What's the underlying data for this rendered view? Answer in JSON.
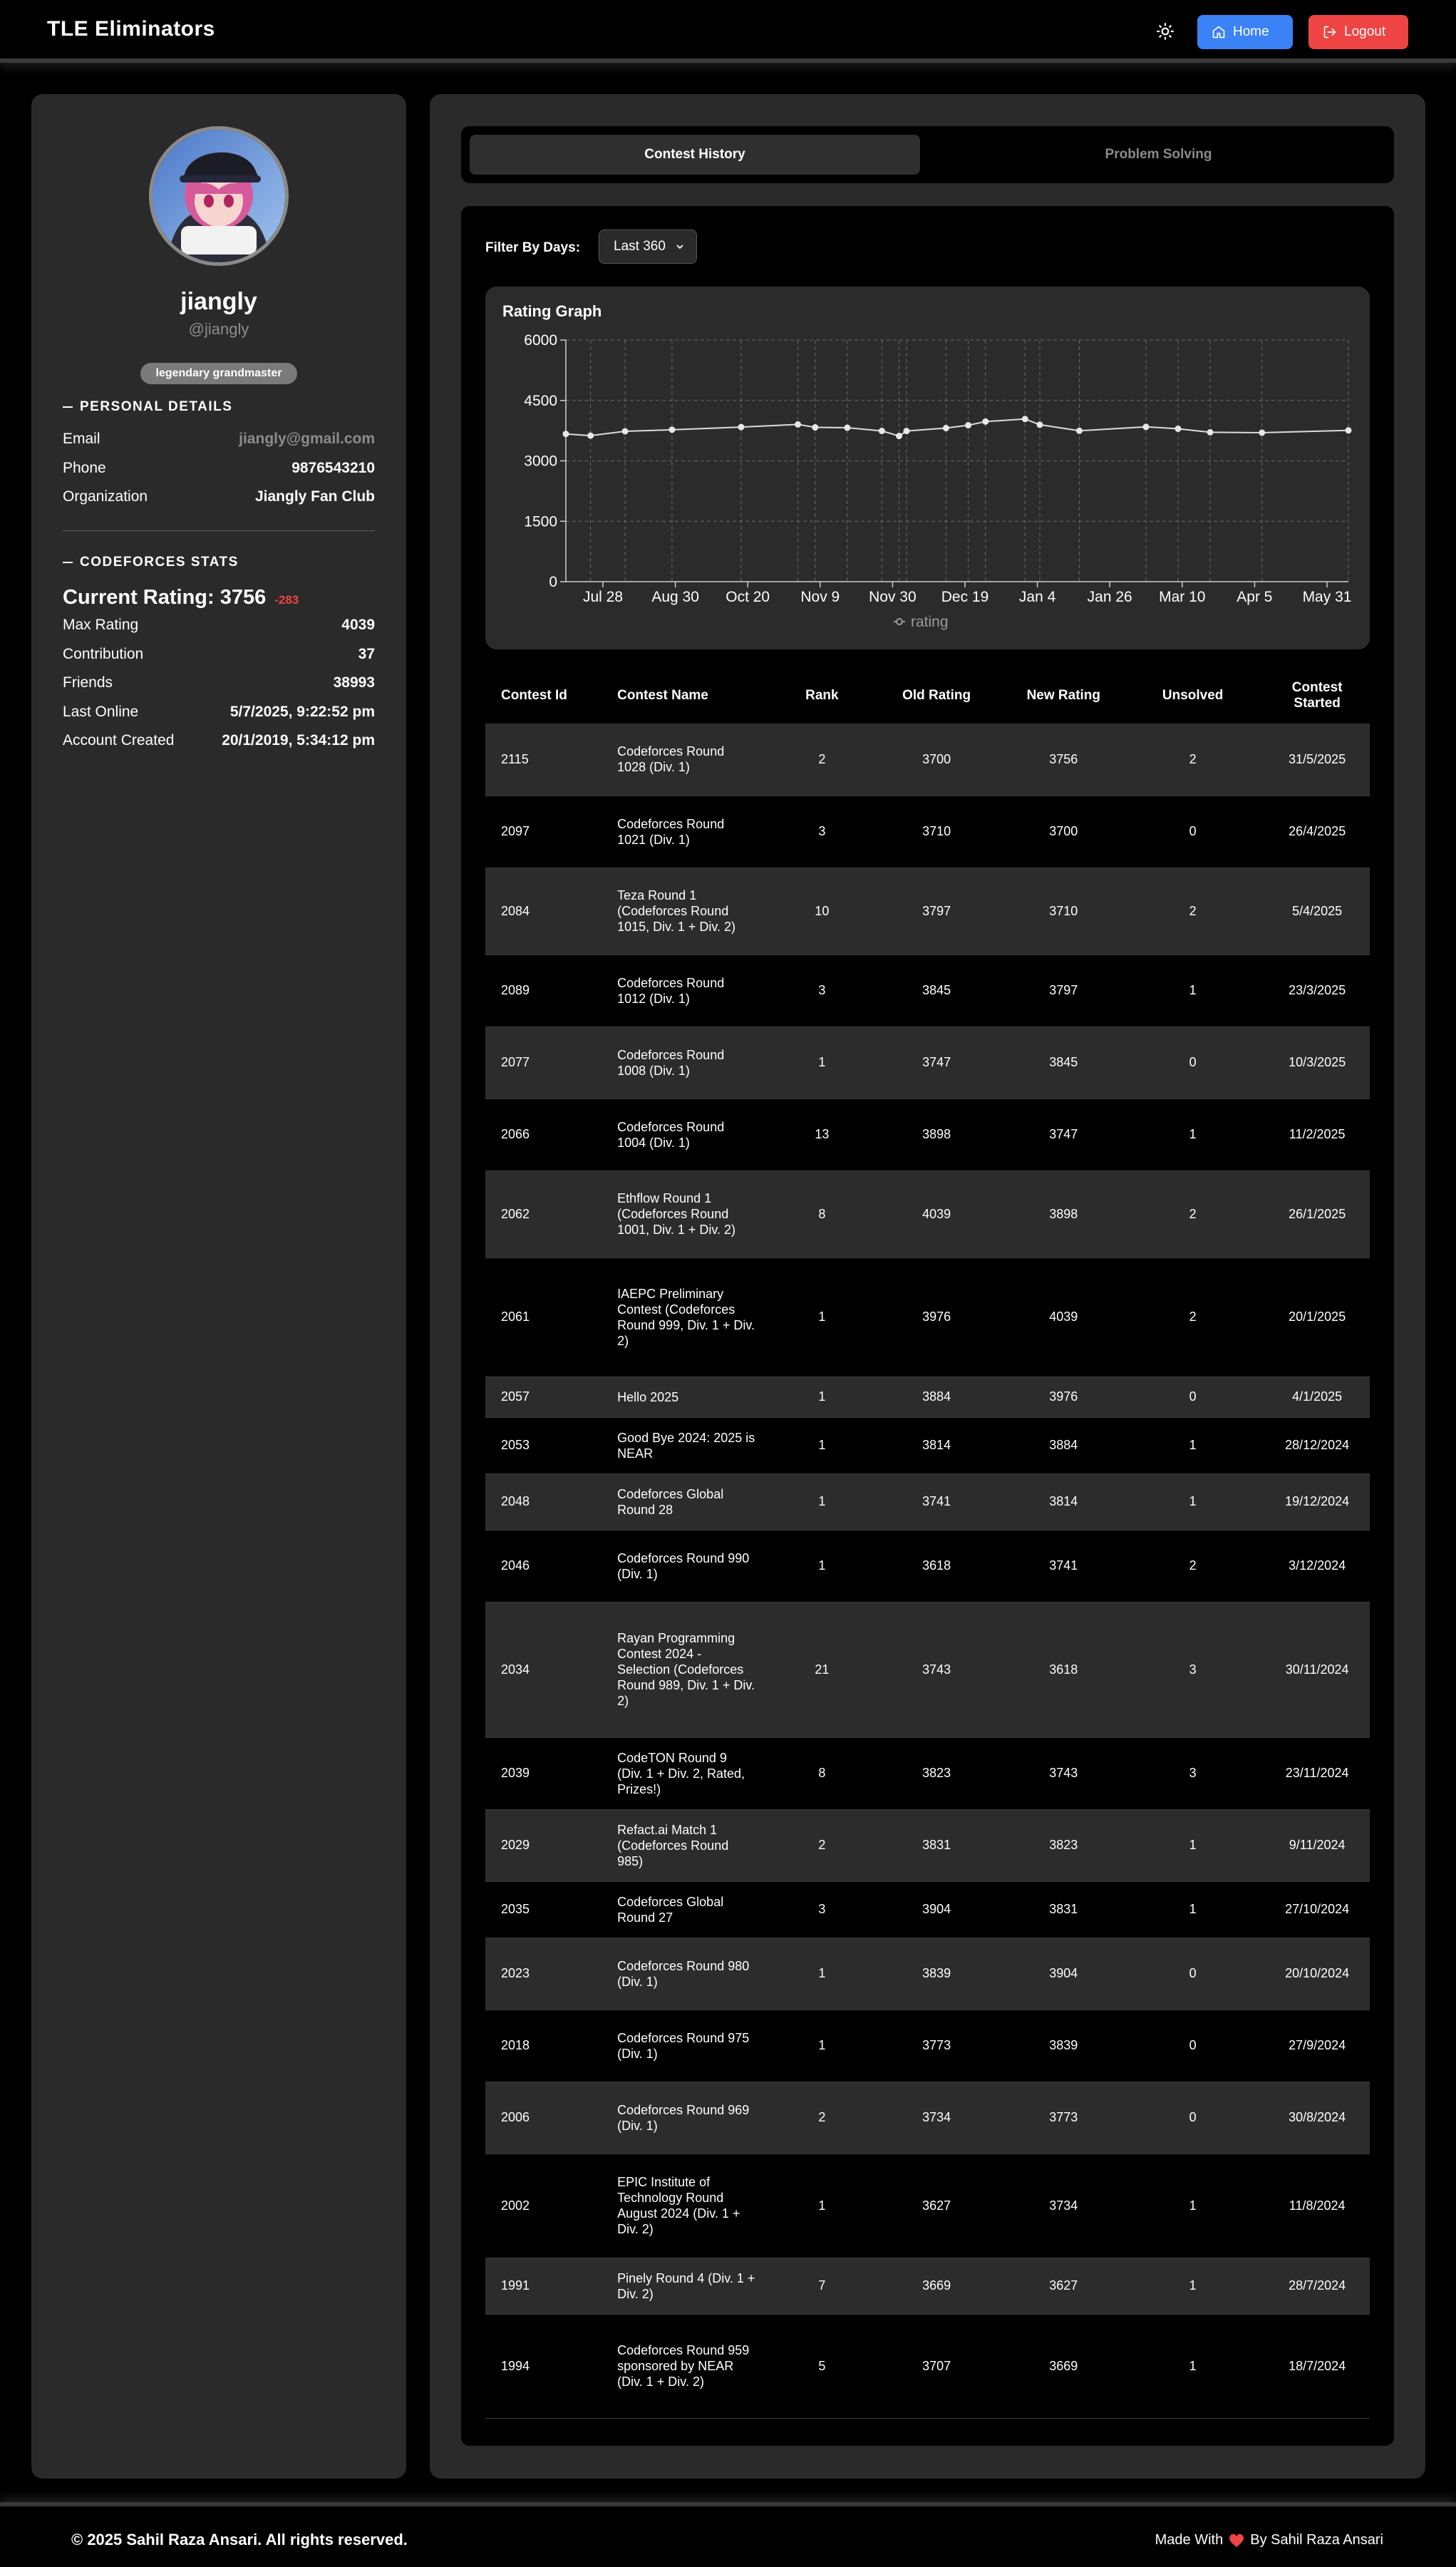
{
  "app": {
    "brand": "TLE Eliminators",
    "home_label": "Home",
    "logout_label": "Logout"
  },
  "profile": {
    "username": "jiangly",
    "handle": "@jiangly",
    "rank": "legendary grandmaster",
    "personal_title": "PERSONAL DETAILS",
    "personal": [
      {
        "label": "Email",
        "value": "jiangly@gmail.com"
      },
      {
        "label": "Phone",
        "value": "9876543210"
      },
      {
        "label": "Organization",
        "value": "Jiangly Fan Club"
      }
    ],
    "stats_title": "CODEFORCES STATS",
    "current_rating_label": "Current Rating: 3756",
    "current_rating_delta": "-283",
    "stats": [
      {
        "label": "Max Rating",
        "value": "4039"
      },
      {
        "label": "Contribution",
        "value": "37"
      },
      {
        "label": "Friends",
        "value": "38993"
      },
      {
        "label": "Last Online",
        "value": "5/7/2025, 9:22:52 pm"
      },
      {
        "label": "Account Created",
        "value": "20/1/2019, 5:34:12 pm"
      }
    ]
  },
  "tabs": {
    "contest_history": "Contest History",
    "problem_solving": "Problem Solving"
  },
  "filter": {
    "label": "Filter By Days:",
    "selected": "Last 360"
  },
  "chart_data": {
    "type": "line",
    "title": "Rating Graph",
    "legend": "rating",
    "legend_position": "bottom",
    "grid": true,
    "ylim": [
      0,
      6000
    ],
    "yticks": [
      "0",
      "1500",
      "3000",
      "4500",
      "6000"
    ],
    "xticks": [
      "Jul 28",
      "Aug 30",
      "Oct 20",
      "Nov 9",
      "Nov 30",
      "Dec 19",
      "Jan 4",
      "Jan 26",
      "Mar 10",
      "Apr 5",
      "May 31"
    ],
    "series": [
      {
        "name": "rating",
        "x": [
          "18/7/2024",
          "28/7/2024",
          "11/8/2024",
          "30/8/2024",
          "27/9/2024",
          "20/10/2024",
          "27/10/2024",
          "9/11/2024",
          "23/11/2024",
          "30/11/2024",
          "3/12/2024",
          "19/12/2024",
          "28/12/2024",
          "4/1/2025",
          "20/1/2025",
          "26/1/2025",
          "11/2/2025",
          "10/3/2025",
          "23/3/2025",
          "5/4/2025",
          "26/4/2025",
          "31/5/2025"
        ],
        "values": [
          3669,
          3627,
          3734,
          3773,
          3839,
          3904,
          3831,
          3823,
          3743,
          3618,
          3741,
          3814,
          3884,
          3976,
          4039,
          3898,
          3747,
          3845,
          3797,
          3710,
          3700,
          3756
        ]
      }
    ]
  },
  "table": {
    "headers": [
      "Contest Id",
      "Contest Name",
      "Rank",
      "Old Rating",
      "New Rating",
      "Unsolved",
      "Contest Started"
    ],
    "rows": [
      [
        "2115",
        "Codeforces Round 1028 (Div. 1)",
        "2",
        "3700",
        "3756",
        "2",
        "31/5/2025"
      ],
      [
        "2097",
        "Codeforces Round 1021 (Div. 1)",
        "3",
        "3710",
        "3700",
        "0",
        "26/4/2025"
      ],
      [
        "2084",
        "Teza Round 1 (Codeforces Round 1015, Div. 1 + Div. 2)",
        "10",
        "3797",
        "3710",
        "2",
        "5/4/2025"
      ],
      [
        "2089",
        "Codeforces Round 1012 (Div. 1)",
        "3",
        "3845",
        "3797",
        "1",
        "23/3/2025"
      ],
      [
        "2077",
        "Codeforces Round 1008 (Div. 1)",
        "1",
        "3747",
        "3845",
        "0",
        "10/3/2025"
      ],
      [
        "2066",
        "Codeforces Round 1004 (Div. 1)",
        "13",
        "3898",
        "3747",
        "1",
        "11/2/2025"
      ],
      [
        "2062",
        "Ethflow Round 1 (Codeforces Round 1001, Div. 1 + Div. 2)",
        "8",
        "4039",
        "3898",
        "2",
        "26/1/2025"
      ],
      [
        "2061",
        "IAEPC Preliminary Contest (Codeforces Round 999, Div. 1 + Div. 2)",
        "1",
        "3976",
        "4039",
        "2",
        "20/1/2025"
      ],
      [
        "2057",
        "Hello 2025",
        "1",
        "3884",
        "3976",
        "0",
        "4/1/2025"
      ],
      [
        "2053",
        "Good Bye 2024: 2025 is NEAR",
        "1",
        "3814",
        "3884",
        "1",
        "28/12/2024"
      ],
      [
        "2048",
        "Codeforces Global Round 28",
        "1",
        "3741",
        "3814",
        "1",
        "19/12/2024"
      ],
      [
        "2046",
        "Codeforces Round 990 (Div. 1)",
        "1",
        "3618",
        "3741",
        "2",
        "3/12/2024"
      ],
      [
        "2034",
        "Rayan Programming Contest 2024 - Selection (Codeforces Round 989, Div. 1 + Div. 2)",
        "21",
        "3743",
        "3618",
        "3",
        "30/11/2024"
      ],
      [
        "2039",
        "CodeTON Round 9 (Div. 1 + Div. 2, Rated, Prizes!)",
        "8",
        "3823",
        "3743",
        "3",
        "23/11/2024"
      ],
      [
        "2029",
        "Refact.ai Match 1 (Codeforces Round 985)",
        "2",
        "3831",
        "3823",
        "1",
        "9/11/2024"
      ],
      [
        "2035",
        "Codeforces Global Round 27",
        "3",
        "3904",
        "3831",
        "1",
        "27/10/2024"
      ],
      [
        "2023",
        "Codeforces Round 980 (Div. 1)",
        "1",
        "3839",
        "3904",
        "0",
        "20/10/2024"
      ],
      [
        "2018",
        "Codeforces Round 975 (Div. 1)",
        "1",
        "3773",
        "3839",
        "0",
        "27/9/2024"
      ],
      [
        "2006",
        "Codeforces Round 969 (Div. 1)",
        "2",
        "3734",
        "3773",
        "0",
        "30/8/2024"
      ],
      [
        "2002",
        "EPIC Institute of Technology Round August 2024 (Div. 1 + Div. 2)",
        "1",
        "3627",
        "3734",
        "1",
        "11/8/2024"
      ],
      [
        "1991",
        "Pinely Round 4 (Div. 1 + Div. 2)",
        "7",
        "3669",
        "3627",
        "1",
        "28/7/2024"
      ],
      [
        "1994",
        "Codeforces Round 959 sponsored by NEAR (Div. 1 + Div. 2)",
        "5",
        "3707",
        "3669",
        "1",
        "18/7/2024"
      ]
    ]
  },
  "footer": {
    "copyright": "© 2025 Sahil Raza Ansari. All rights reserved.",
    "made_with": "Made With",
    "by": "By Sahil Raza Ansari"
  },
  "colors": {
    "home": "#3b82f6",
    "logout": "#ef4444",
    "delta": "#ef4444",
    "heart": "#ef4444"
  },
  "icons": {
    "theme": "sun-icon",
    "home": "home-icon",
    "logout": "logout-icon",
    "select": "chevron-down-icon",
    "heart": "heart-icon"
  }
}
